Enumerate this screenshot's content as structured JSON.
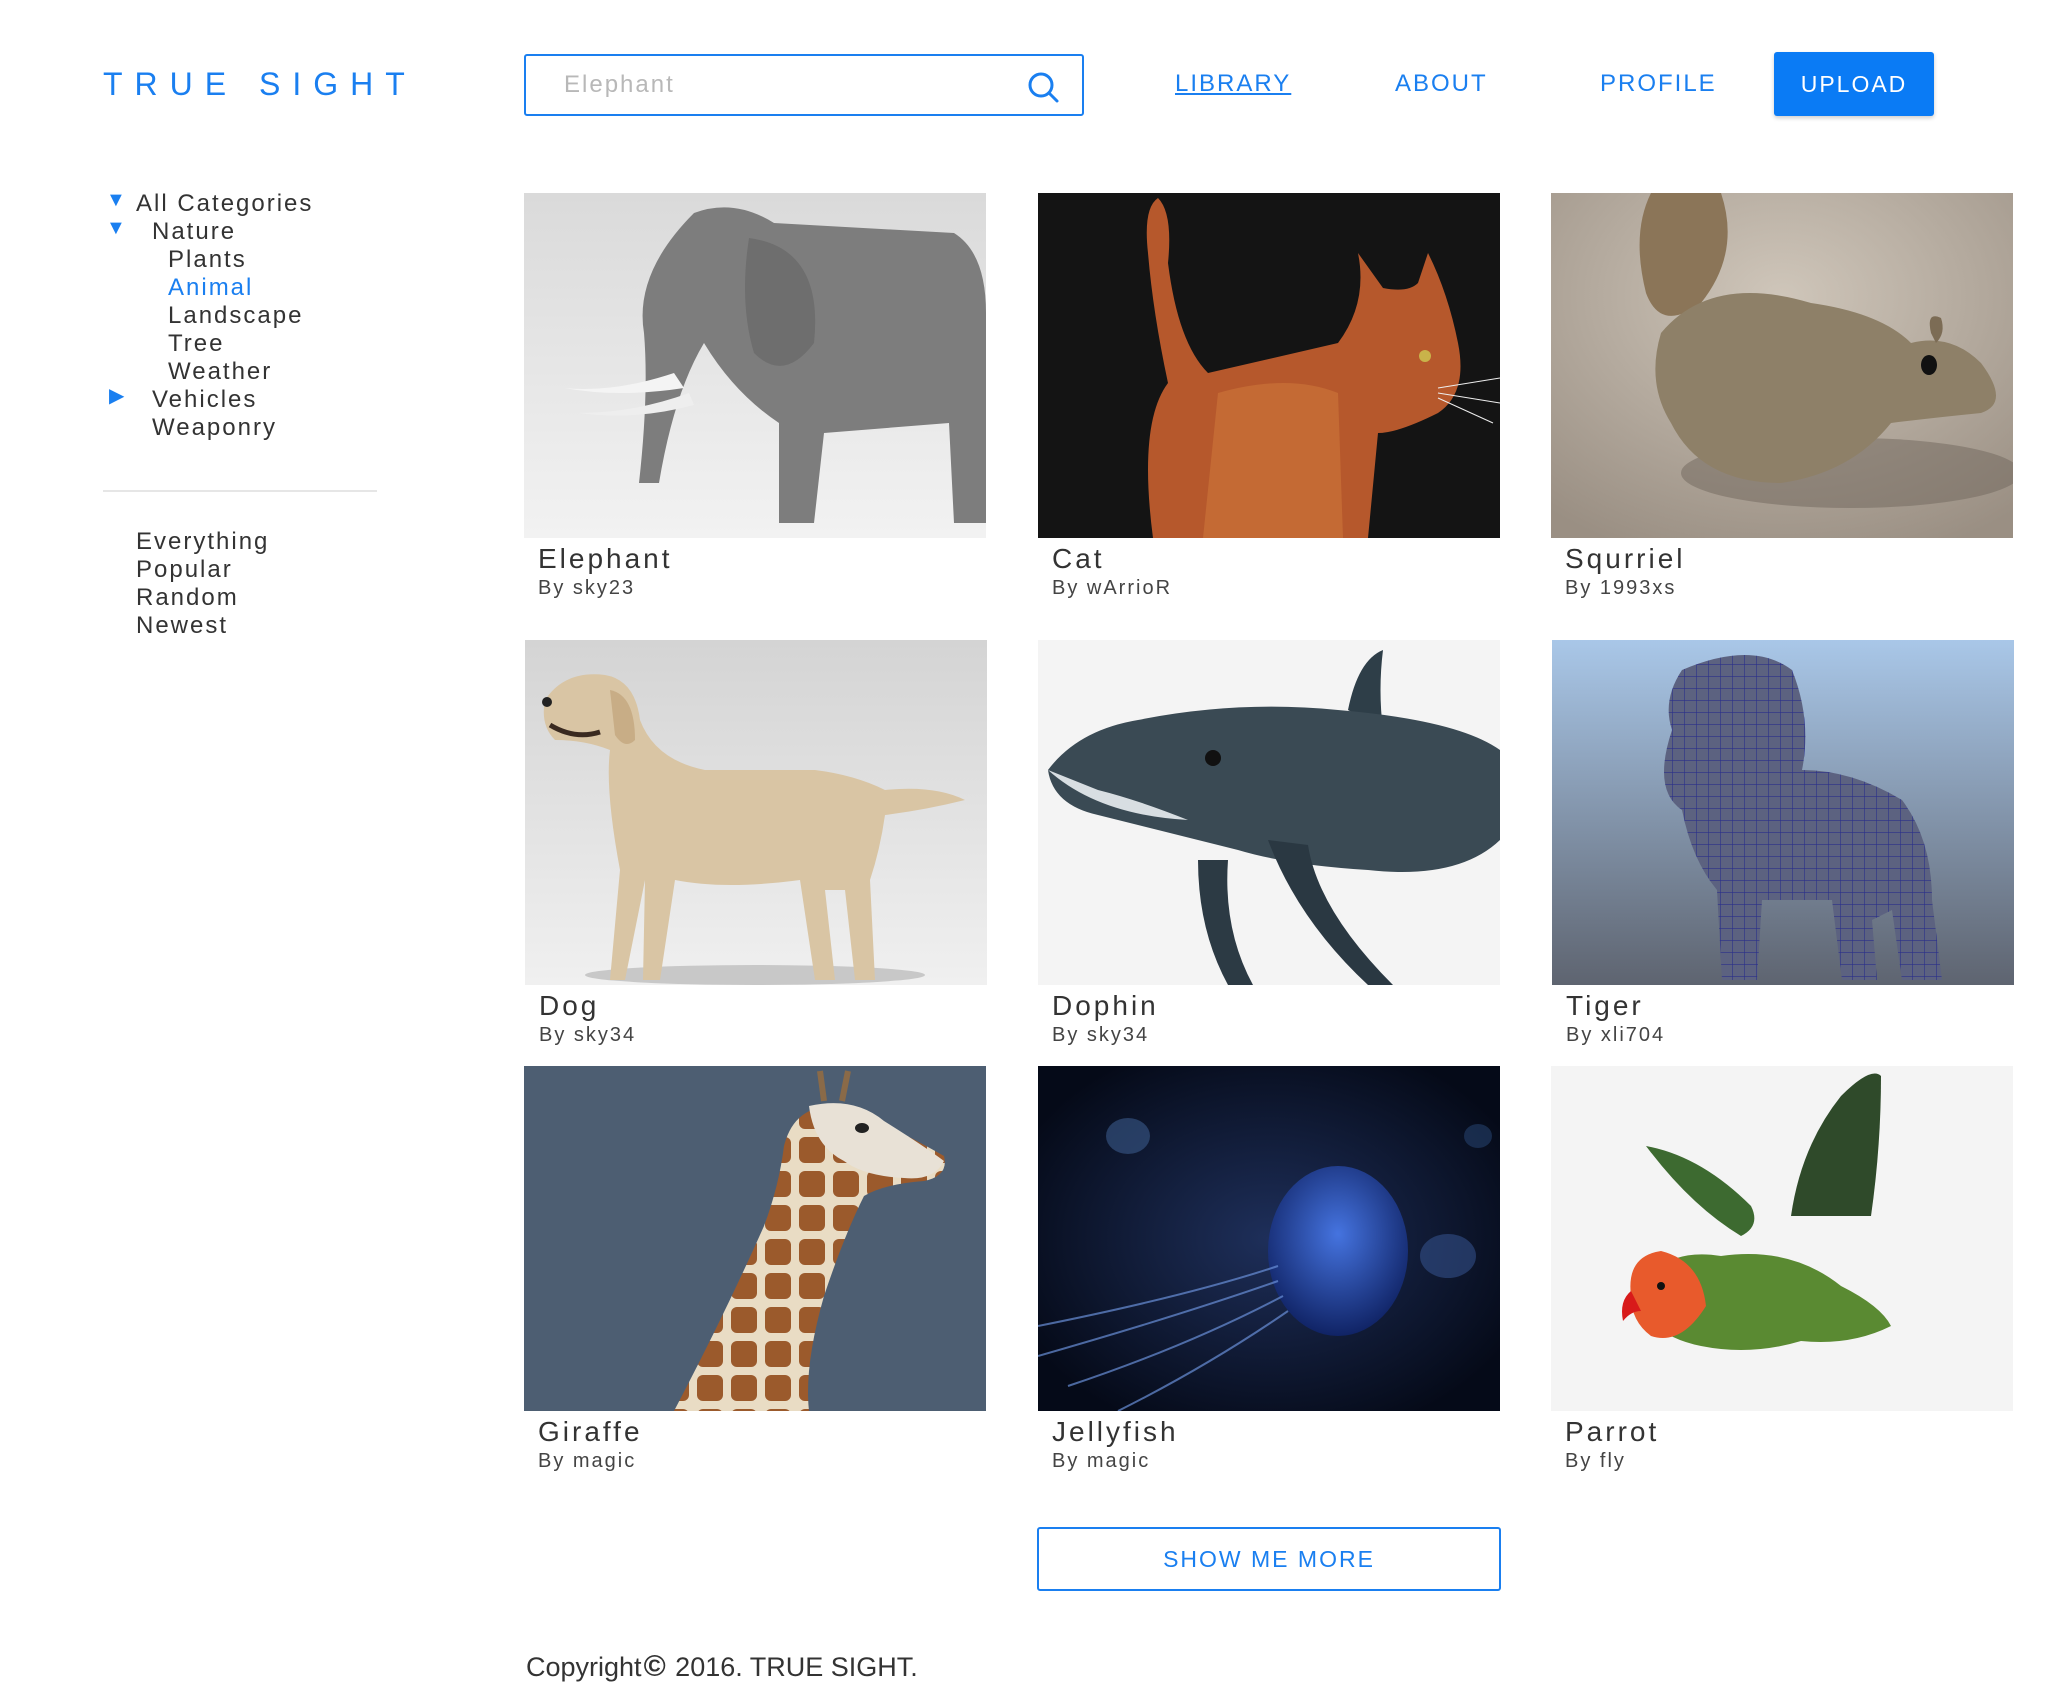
{
  "app": {
    "logo": "TRUE SIGHT"
  },
  "search": {
    "placeholder": "Elephant",
    "icon": "search-icon"
  },
  "nav": {
    "library": "LIBRARY",
    "about": "ABOUT",
    "profile": "PROFILE",
    "upload": "UPLOAD"
  },
  "sidebar": {
    "categories": [
      {
        "label": "All Categories",
        "indicator": "expanded"
      },
      {
        "label": "Nature",
        "indicator": "expanded"
      },
      {
        "label": "Plants"
      },
      {
        "label": "Animal",
        "selected": true
      },
      {
        "label": "Landscape"
      },
      {
        "label": "Tree"
      },
      {
        "label": "Weather"
      },
      {
        "label": "Vehicles",
        "indicator": "collapsed"
      },
      {
        "label": "Weaponry"
      }
    ],
    "sort": [
      "Everything",
      "Popular",
      "Random",
      "Newest"
    ]
  },
  "models": [
    {
      "title": "Elephant",
      "author": "By sky23"
    },
    {
      "title": "Cat",
      "author": "By wArrioR"
    },
    {
      "title": "Squrriel",
      "author": "By 1993xs"
    },
    {
      "title": "Dog",
      "author": "By sky34"
    },
    {
      "title": "Dophin",
      "author": "By sky34"
    },
    {
      "title": "Tiger",
      "author": "By xli704"
    },
    {
      "title": "Giraffe",
      "author": "By magic"
    },
    {
      "title": "Jellyfish",
      "author": "By magic"
    },
    {
      "title": "Parrot",
      "author": "By fly"
    }
  ],
  "more_button": "SHOW ME MORE",
  "footer": {
    "prefix": "Copyright",
    "symbol": "©",
    "suffix": " 2016. TRUE SIGHT."
  },
  "colors": {
    "accent": "#1a7ff0",
    "button": "#0a7bf5",
    "text": "#333333"
  }
}
